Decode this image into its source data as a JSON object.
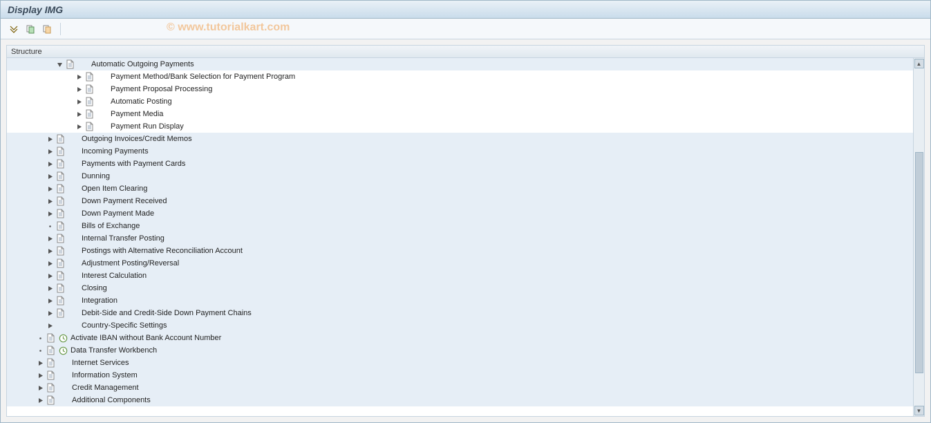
{
  "title": "Display IMG",
  "watermark": "© www.tutorialkart.com",
  "tree_header": "Structure",
  "tree": [
    {
      "indent": 5,
      "twisty": "open",
      "doc": true,
      "clock": false,
      "label_key": "n.auto_out_pay",
      "bg": "blue"
    },
    {
      "indent": 7,
      "twisty": "closed",
      "doc": true,
      "clock": false,
      "label_key": "n.pm_bank_sel",
      "bg": "white"
    },
    {
      "indent": 7,
      "twisty": "closed",
      "doc": true,
      "clock": false,
      "label_key": "n.pay_prop_proc",
      "bg": "white"
    },
    {
      "indent": 7,
      "twisty": "closed",
      "doc": true,
      "clock": false,
      "label_key": "n.auto_posting",
      "bg": "white"
    },
    {
      "indent": 7,
      "twisty": "closed",
      "doc": true,
      "clock": false,
      "label_key": "n.pay_media",
      "bg": "white"
    },
    {
      "indent": 7,
      "twisty": "closed",
      "doc": true,
      "clock": false,
      "label_key": "n.pay_run_disp",
      "bg": "white"
    },
    {
      "indent": 4,
      "twisty": "closed",
      "doc": true,
      "clock": false,
      "label_key": "n.out_inv_cred",
      "bg": "blue"
    },
    {
      "indent": 4,
      "twisty": "closed",
      "doc": true,
      "clock": false,
      "label_key": "n.inc_pay",
      "bg": "blue"
    },
    {
      "indent": 4,
      "twisty": "closed",
      "doc": true,
      "clock": false,
      "label_key": "n.pay_cards",
      "bg": "blue"
    },
    {
      "indent": 4,
      "twisty": "closed",
      "doc": true,
      "clock": false,
      "label_key": "n.dunning",
      "bg": "blue"
    },
    {
      "indent": 4,
      "twisty": "closed",
      "doc": true,
      "clock": false,
      "label_key": "n.open_item",
      "bg": "blue"
    },
    {
      "indent": 4,
      "twisty": "closed",
      "doc": true,
      "clock": false,
      "label_key": "n.down_recv",
      "bg": "blue"
    },
    {
      "indent": 4,
      "twisty": "closed",
      "doc": true,
      "clock": false,
      "label_key": "n.down_made",
      "bg": "blue"
    },
    {
      "indent": 4,
      "twisty": "leaf",
      "doc": true,
      "clock": false,
      "label_key": "n.bills_exch",
      "bg": "blue"
    },
    {
      "indent": 4,
      "twisty": "closed",
      "doc": true,
      "clock": false,
      "label_key": "n.int_transfer",
      "bg": "blue"
    },
    {
      "indent": 4,
      "twisty": "closed",
      "doc": true,
      "clock": false,
      "label_key": "n.alt_recon",
      "bg": "blue"
    },
    {
      "indent": 4,
      "twisty": "closed",
      "doc": true,
      "clock": false,
      "label_key": "n.adj_post",
      "bg": "blue"
    },
    {
      "indent": 4,
      "twisty": "closed",
      "doc": true,
      "clock": false,
      "label_key": "n.interest",
      "bg": "blue"
    },
    {
      "indent": 4,
      "twisty": "closed",
      "doc": true,
      "clock": false,
      "label_key": "n.closing",
      "bg": "blue"
    },
    {
      "indent": 4,
      "twisty": "closed",
      "doc": true,
      "clock": false,
      "label_key": "n.integration",
      "bg": "blue"
    },
    {
      "indent": 4,
      "twisty": "closed",
      "doc": true,
      "clock": false,
      "label_key": "n.debit_credit",
      "bg": "blue"
    },
    {
      "indent": 4,
      "twisty": "closed",
      "doc": false,
      "clock": false,
      "label_key": "n.country_spec",
      "bg": "blue"
    },
    {
      "indent": 3,
      "twisty": "leaf",
      "doc": true,
      "clock": true,
      "label_key": "n.iban",
      "bg": "blue"
    },
    {
      "indent": 3,
      "twisty": "leaf",
      "doc": true,
      "clock": true,
      "label_key": "n.data_transfer",
      "bg": "blue"
    },
    {
      "indent": 3,
      "twisty": "closed",
      "doc": true,
      "clock": false,
      "label_key": "n.internet",
      "bg": "blue"
    },
    {
      "indent": 3,
      "twisty": "closed",
      "doc": true,
      "clock": false,
      "label_key": "n.info_sys",
      "bg": "blue"
    },
    {
      "indent": 3,
      "twisty": "closed",
      "doc": true,
      "clock": false,
      "label_key": "n.credit_mgmt",
      "bg": "blue"
    },
    {
      "indent": 3,
      "twisty": "closed",
      "doc": true,
      "clock": false,
      "label_key": "n.add_comp",
      "bg": "blue"
    }
  ],
  "n": {
    "auto_out_pay": "Automatic Outgoing Payments",
    "pm_bank_sel": "Payment Method/Bank Selection for Payment Program",
    "pay_prop_proc": "Payment Proposal Processing",
    "auto_posting": "Automatic Posting",
    "pay_media": "Payment Media",
    "pay_run_disp": "Payment Run Display",
    "out_inv_cred": "Outgoing Invoices/Credit Memos",
    "inc_pay": "Incoming Payments",
    "pay_cards": "Payments with Payment Cards",
    "dunning": "Dunning",
    "open_item": "Open Item Clearing",
    "down_recv": "Down Payment Received",
    "down_made": "Down Payment Made",
    "bills_exch": "Bills of Exchange",
    "int_transfer": "Internal Transfer Posting",
    "alt_recon": "Postings with Alternative Reconciliation Account",
    "adj_post": "Adjustment Posting/Reversal",
    "interest": "Interest Calculation",
    "closing": "Closing",
    "integration": "Integration",
    "debit_credit": "Debit-Side and Credit-Side Down Payment Chains",
    "country_spec": "Country-Specific Settings",
    "iban": "Activate IBAN without Bank Account Number",
    "data_transfer": "Data Transfer Workbench",
    "internet": "Internet Services",
    "info_sys": "Information System",
    "credit_mgmt": "Credit Management",
    "add_comp": "Additional Components"
  }
}
